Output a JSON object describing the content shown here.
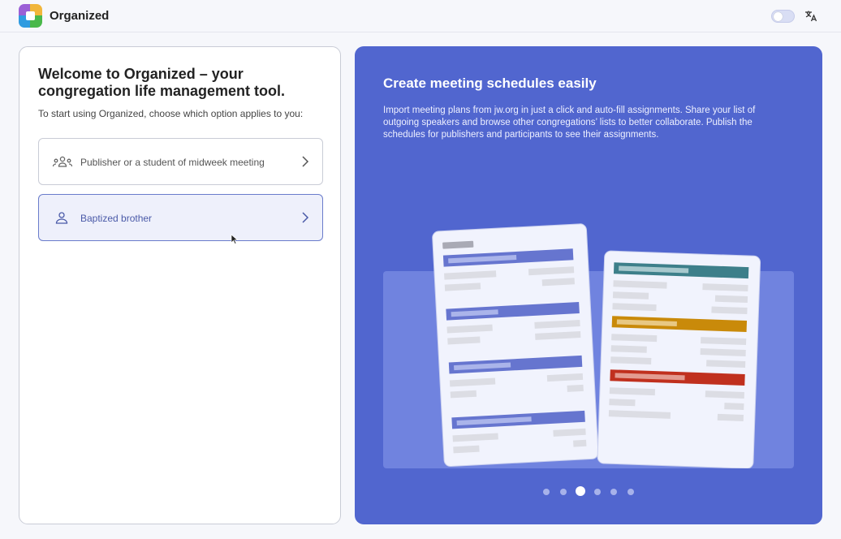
{
  "header": {
    "app_title": "Organized",
    "logo_icon": "organized-logo-icon",
    "theme_toggle_icon": "theme-toggle",
    "language_icon": "translate-icon"
  },
  "welcome": {
    "title": "Welcome to Organized – your congregation life management tool.",
    "subtitle": "To start using Organized, choose which option applies to you:",
    "options": [
      {
        "label": "Publisher or a student of midweek meeting",
        "icon": "group-icon",
        "selected": false
      },
      {
        "label": "Baptized brother",
        "icon": "person-icon",
        "selected": true
      }
    ]
  },
  "slide": {
    "title": "Create meeting schedules easily",
    "description": "Import meeting plans from jw.org in just a click and auto-fill assignments. Share your list of outgoing speakers and browse other congregations’ lists to better collaborate. Publish the schedules for publishers and participants to see their assignments.",
    "dots": {
      "count": 6,
      "active_index": 2
    }
  },
  "colors": {
    "accent": "#5166cf",
    "selected_bg": "#eef0fb",
    "teal_bar": "#3d7f8a",
    "gold_bar": "#c98a0a",
    "red_bar": "#c0301e",
    "doc_bar_blue": "#6675cf"
  }
}
